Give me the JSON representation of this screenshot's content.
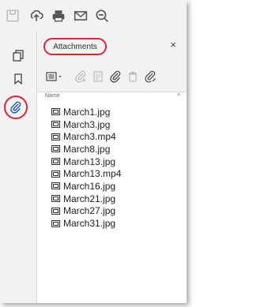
{
  "toolbar": {
    "icons": [
      "save-icon",
      "upload-icon",
      "print-icon",
      "email-icon",
      "zoom-out-icon"
    ]
  },
  "leftbar": {
    "icons": [
      "pages-icon",
      "bookmark-icon",
      "attachment-icon"
    ]
  },
  "panel": {
    "title": "Attachments",
    "close_label": "×",
    "tools": [
      "options-menu-icon",
      "add-attachment-icon",
      "open-icon",
      "save-attachment-icon",
      "delete-icon",
      "edit-description-icon"
    ],
    "column_header": "Name",
    "sort_indicator": "^",
    "files": [
      "March1.jpg",
      "March3.jpg",
      "March3.mp4",
      "March8.jpg",
      "March13.jpg",
      "March13.mp4",
      "March16.jpg",
      "March21.jpg",
      "March27.jpg",
      "March31.jpg"
    ]
  },
  "colors": {
    "highlight": "#d22b3a",
    "toolbar_bg": "#f2f2f2",
    "panel_bg": "#ffffff"
  }
}
